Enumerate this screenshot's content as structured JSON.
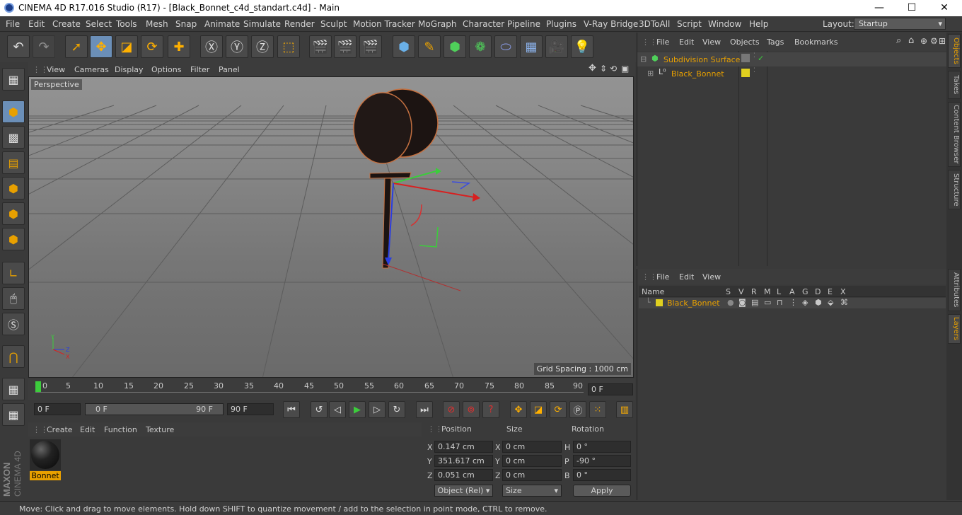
{
  "window": {
    "title": "CINEMA 4D R17.016 Studio (R17) - [Black_Bonnet_c4d_standart.c4d] - Main",
    "min": "—",
    "max": "☐",
    "close": "✕"
  },
  "menubar": {
    "items": [
      "File",
      "Edit",
      "Create",
      "Select",
      "Tools",
      "Mesh",
      "Snap",
      "Animate",
      "Simulate",
      "Render",
      "Sculpt",
      "Motion Tracker",
      "MoGraph",
      "Character",
      "Pipeline",
      "Plugins",
      "V-Ray Bridge",
      "3DToAll",
      "Script",
      "Window",
      "Help"
    ],
    "layout_label": "Layout:",
    "layout_value": "Startup"
  },
  "viewport": {
    "menu": [
      "View",
      "Cameras",
      "Display",
      "Options",
      "Filter",
      "Panel"
    ],
    "label": "Perspective",
    "grid_spacing": "Grid Spacing : 1000 cm"
  },
  "timeline": {
    "ticks": [
      "0",
      "5",
      "10",
      "15",
      "20",
      "25",
      "30",
      "35",
      "40",
      "45",
      "50",
      "55",
      "60",
      "65",
      "70",
      "75",
      "80",
      "85",
      "90"
    ],
    "current": "0 F"
  },
  "playbar": {
    "start": "0 F",
    "range_start": "0 F",
    "range_end": "90 F",
    "end": "90 F"
  },
  "material_manager": {
    "menu": [
      "Create",
      "Edit",
      "Function",
      "Texture"
    ],
    "material_name": "Bonnet"
  },
  "coordinates": {
    "headers": [
      "Position",
      "Size",
      "Rotation"
    ],
    "rows": [
      {
        "axis": "X",
        "pos": "0.147 cm",
        "size_axis": "X",
        "size": "0 cm",
        "rot_axis": "H",
        "rot": "0 °"
      },
      {
        "axis": "Y",
        "pos": "351.617 cm",
        "size_axis": "Y",
        "size": "0 cm",
        "rot_axis": "P",
        "rot": "-90 °"
      },
      {
        "axis": "Z",
        "pos": "0.051 cm",
        "size_axis": "Z",
        "size": "0 cm",
        "rot_axis": "B",
        "rot": "0 °"
      }
    ],
    "mode": "Object (Rel)",
    "size_mode": "Size",
    "apply": "Apply"
  },
  "object_manager": {
    "menu": [
      "File",
      "Edit",
      "View",
      "Objects",
      "Tags",
      "Bookmarks"
    ],
    "objects": [
      "Subdivision Surface",
      "Black_Bonnet"
    ]
  },
  "layer_manager": {
    "menu": [
      "File",
      "Edit",
      "View"
    ],
    "columns": [
      "Name",
      "S",
      "V",
      "R",
      "M",
      "L",
      "A",
      "G",
      "D",
      "E",
      "X"
    ],
    "layer": "Black_Bonnet"
  },
  "right_tabs": [
    "Objects",
    "Takes",
    "Content Browser",
    "Structure",
    "Attributes",
    "Layers"
  ],
  "brand": {
    "line1": "MAXON",
    "line2": "CINEMA 4D"
  },
  "status": "Move: Click and drag to move elements. Hold down SHIFT to quantize movement / add to the selection in point mode, CTRL to remove.",
  "colors": {
    "accent": "#e8a000",
    "selected_tool": "#6b8fb8"
  }
}
